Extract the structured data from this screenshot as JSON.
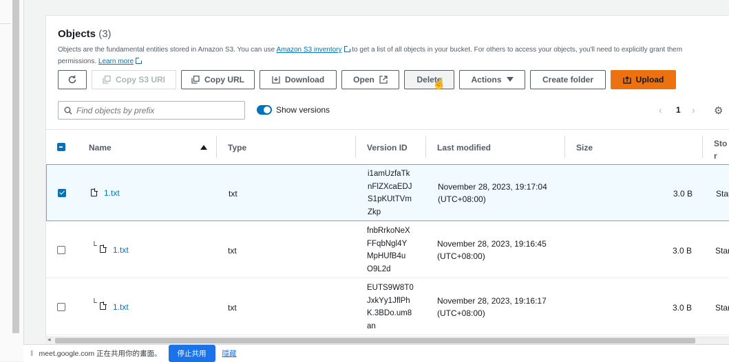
{
  "objects": {
    "title": "Objects",
    "count": "(3)",
    "description_prefix": "Objects are the fundamental entities stored in Amazon S3. You can use",
    "inventory_link": "Amazon S3 inventory",
    "description_middle": "to get a list of all objects in your bucket. For others to access your objects, you'll need to explicitly grant them permissions.",
    "learn_more": "Learn more"
  },
  "toolbar": {
    "copy_s3_uri": "Copy S3 URI",
    "copy_url": "Copy URL",
    "download": "Download",
    "open": "Open",
    "delete": "Delete",
    "actions": "Actions",
    "create_folder": "Create folder",
    "upload": "Upload"
  },
  "search": {
    "placeholder": "Find objects by prefix"
  },
  "show_versions": {
    "label": "Show versions",
    "enabled": true
  },
  "pagination": {
    "page": "1"
  },
  "table": {
    "headers": {
      "name": "Name",
      "type": "Type",
      "version_id": "Version ID",
      "last_modified": "Last modified",
      "size": "Size",
      "storage_class": "Stor clas"
    },
    "rows": [
      {
        "name": "1.txt",
        "type": "txt",
        "version": [
          "i1amUzfaTk",
          "nFlZXcaEDJ",
          "S1pKUtTVm",
          "Zkp"
        ],
        "modified_date": "November 28, 2023, 19:17:04",
        "modified_tz": "(UTC+08:00)",
        "size": "3.0 B",
        "storage": "Star",
        "selected": true
      },
      {
        "name": "1.txt",
        "type": "txt",
        "version": [
          "fnbRrkoNeX",
          "FFqbNgl4Y",
          "MpHUfB4u",
          "O9L2d"
        ],
        "modified_date": "November 28, 2023, 19:16:45",
        "modified_tz": "(UTC+08:00)",
        "size": "3.0 B",
        "storage": "Star",
        "selected": false
      },
      {
        "name": "1.txt",
        "type": "txt",
        "version": [
          "EUTS9W8T0",
          "JxkYy1JflPh",
          "K.3BDo.um8",
          "an"
        ],
        "modified_date": "November 28, 2023, 19:16:17",
        "modified_tz": "(UTC+08:00)",
        "size": "3.0 B",
        "storage": "Star",
        "selected": false
      }
    ]
  },
  "sharebar": {
    "message": "meet.google.com 正在共用你的畫面。",
    "stop": "停止共用",
    "hide": "隱藏"
  },
  "colors": {
    "accent": "#0073bb",
    "primary_button": "#ec7211"
  }
}
